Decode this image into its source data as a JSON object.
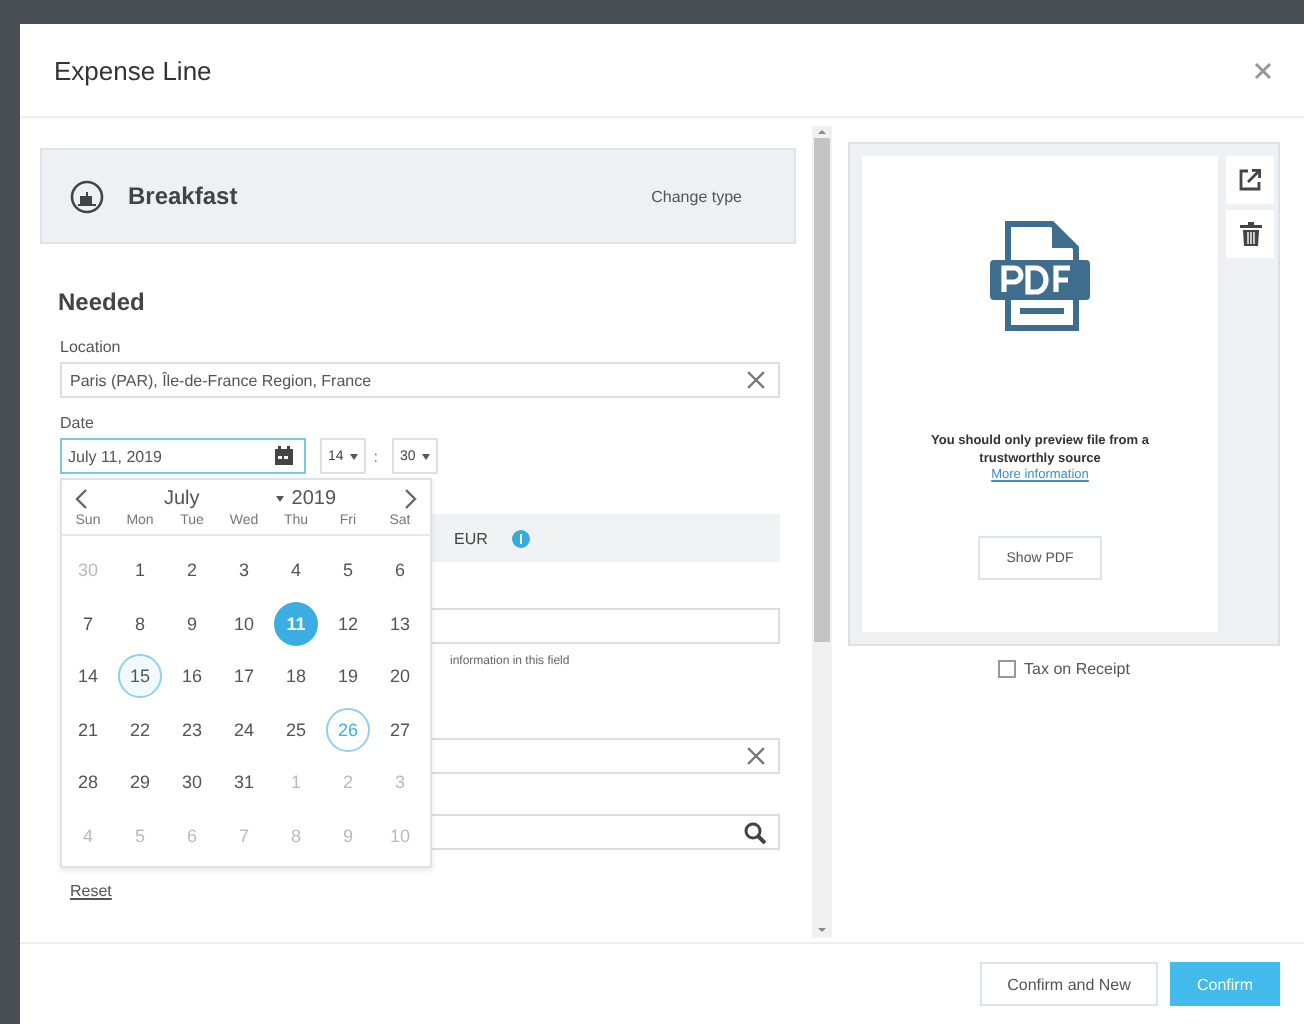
{
  "dialog": {
    "title": "Expense Line"
  },
  "expense_type": {
    "name": "Breakfast",
    "action": "Change type"
  },
  "section": "Needed",
  "location": {
    "label": "Location",
    "value": "Paris (PAR), Île-de-France Region, France"
  },
  "date": {
    "label": "Date",
    "value": "July 11, 2019",
    "hour": "14",
    "minute": "30",
    "separator": ":"
  },
  "calendar": {
    "month": "July",
    "year": "2019",
    "weekdays": [
      "Sun",
      "Mon",
      "Tue",
      "Wed",
      "Thu",
      "Fri",
      "Sat"
    ],
    "days": [
      {
        "label": "30",
        "kind": "outside",
        "selected": false
      },
      {
        "label": "1",
        "kind": "plain",
        "selected": false
      },
      {
        "label": "2",
        "kind": "plain",
        "selected": false
      },
      {
        "label": "3",
        "kind": "plain",
        "selected": false
      },
      {
        "label": "4",
        "kind": "plain",
        "selected": false
      },
      {
        "label": "5",
        "kind": "plain",
        "selected": false
      },
      {
        "label": "6",
        "kind": "plain",
        "selected": false
      },
      {
        "label": "7",
        "kind": "plain",
        "selected": false
      },
      {
        "label": "8",
        "kind": "plain",
        "selected": false
      },
      {
        "label": "9",
        "kind": "plain",
        "selected": false
      },
      {
        "label": "10",
        "kind": "plain",
        "selected": false
      },
      {
        "label": "11",
        "kind": "plain",
        "selected": true
      },
      {
        "label": "12",
        "kind": "plain",
        "selected": false
      },
      {
        "label": "13",
        "kind": "plain",
        "selected": false
      },
      {
        "label": "14",
        "kind": "plain",
        "selected": false
      },
      {
        "label": "15",
        "kind": "ring",
        "selected": false
      },
      {
        "label": "16",
        "kind": "plain",
        "selected": false
      },
      {
        "label": "17",
        "kind": "plain",
        "selected": false
      },
      {
        "label": "18",
        "kind": "plain",
        "selected": false
      },
      {
        "label": "19",
        "kind": "plain",
        "selected": false
      },
      {
        "label": "20",
        "kind": "plain",
        "selected": false
      },
      {
        "label": "21",
        "kind": "plain",
        "selected": false
      },
      {
        "label": "22",
        "kind": "plain",
        "selected": false
      },
      {
        "label": "23",
        "kind": "plain",
        "selected": false
      },
      {
        "label": "24",
        "kind": "plain",
        "selected": false
      },
      {
        "label": "25",
        "kind": "plain",
        "selected": false
      },
      {
        "label": "26",
        "kind": "accent-ring",
        "selected": false
      },
      {
        "label": "27",
        "kind": "plain",
        "selected": false
      },
      {
        "label": "28",
        "kind": "plain",
        "selected": false
      },
      {
        "label": "29",
        "kind": "plain",
        "selected": false
      },
      {
        "label": "30",
        "kind": "plain",
        "selected": false
      },
      {
        "label": "31",
        "kind": "plain",
        "selected": false
      },
      {
        "label": "1",
        "kind": "outside",
        "selected": false
      },
      {
        "label": "2",
        "kind": "outside",
        "selected": false
      },
      {
        "label": "3",
        "kind": "outside",
        "selected": false
      },
      {
        "label": "4",
        "kind": "outside",
        "selected": false
      },
      {
        "label": "5",
        "kind": "outside",
        "selected": false
      },
      {
        "label": "6",
        "kind": "outside",
        "selected": false
      },
      {
        "label": "7",
        "kind": "outside",
        "selected": false
      },
      {
        "label": "8",
        "kind": "outside",
        "selected": false
      },
      {
        "label": "9",
        "kind": "outside",
        "selected": false
      },
      {
        "label": "10",
        "kind": "outside",
        "selected": false
      }
    ]
  },
  "currency": {
    "code": "EUR"
  },
  "hint": "information in this field",
  "reset": "Reset",
  "preview": {
    "warning": "You should only preview file from a trustworthly source",
    "link": "More information",
    "button": "Show PDF"
  },
  "tax_on_receipt": {
    "label": "Tax on Receipt",
    "checked": false
  },
  "buttons": [
    {
      "label": "Confirm and New",
      "kind": "secondary"
    },
    {
      "label": "Confirm",
      "kind": "primary"
    }
  ]
}
